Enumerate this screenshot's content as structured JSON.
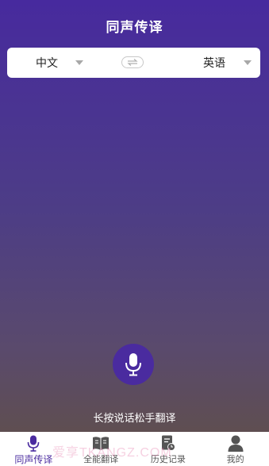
{
  "header": {
    "title": "同声传译"
  },
  "language_bar": {
    "source_language": "中文",
    "target_language": "英语",
    "swap_glyph": "⇆"
  },
  "main": {
    "hint": "长按说话松手翻译"
  },
  "tabbar": {
    "items": [
      {
        "label": "同声传译",
        "icon": "microphone-icon",
        "active": true
      },
      {
        "label": "全能翻译",
        "icon": "book-icon",
        "active": false
      },
      {
        "label": "历史记录",
        "icon": "history-document-icon",
        "active": false
      },
      {
        "label": "我的",
        "icon": "person-icon",
        "active": false
      }
    ]
  },
  "watermark": {
    "text": "爱享TKANGZ.COM"
  },
  "colors": {
    "accent": "#4a2b9f",
    "gradient_top": "#472a9e",
    "gradient_bottom": "#615046"
  }
}
